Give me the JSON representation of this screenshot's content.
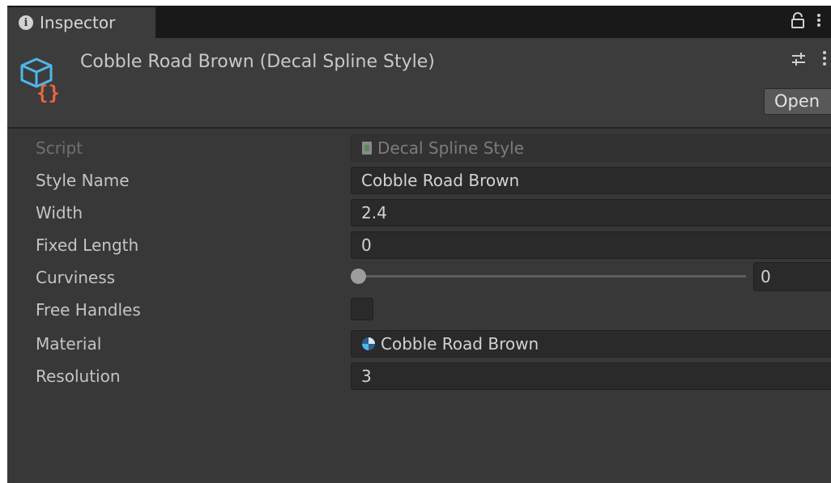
{
  "window": {
    "tab_title": "Inspector",
    "tab_icon": "info-icon",
    "lock_icon": "lock-icon",
    "menu_icon": "more-vertical-icon"
  },
  "header": {
    "asset_title": "Cobble Road Brown (Decal Spline Style)",
    "asset_icon": "scriptable-object-icon",
    "settings_icon": "settings-sliders-icon",
    "open_label": "Open"
  },
  "fields": {
    "script": {
      "label": "Script",
      "value": "Decal Spline Style",
      "icon": "script-file-icon",
      "picker_icon": "object-picker-icon"
    },
    "style_name": {
      "label": "Style Name",
      "value": "Cobble Road Brown"
    },
    "width": {
      "label": "Width",
      "value": "2.4"
    },
    "fixed_length": {
      "label": "Fixed Length",
      "value": "0"
    },
    "curviness": {
      "label": "Curviness",
      "value": "0",
      "slider_fraction": 0
    },
    "free_handles": {
      "label": "Free Handles",
      "checked": false
    },
    "material": {
      "label": "Material",
      "value": "Cobble Road Brown",
      "icon": "material-sphere-icon",
      "picker_icon": "object-picker-icon"
    },
    "resolution": {
      "label": "Resolution",
      "value": "3"
    }
  },
  "colors": {
    "accent_icon_blue": "#4fb6e8",
    "accent_icon_orange": "#e8673c",
    "panel_bg": "#383838"
  }
}
